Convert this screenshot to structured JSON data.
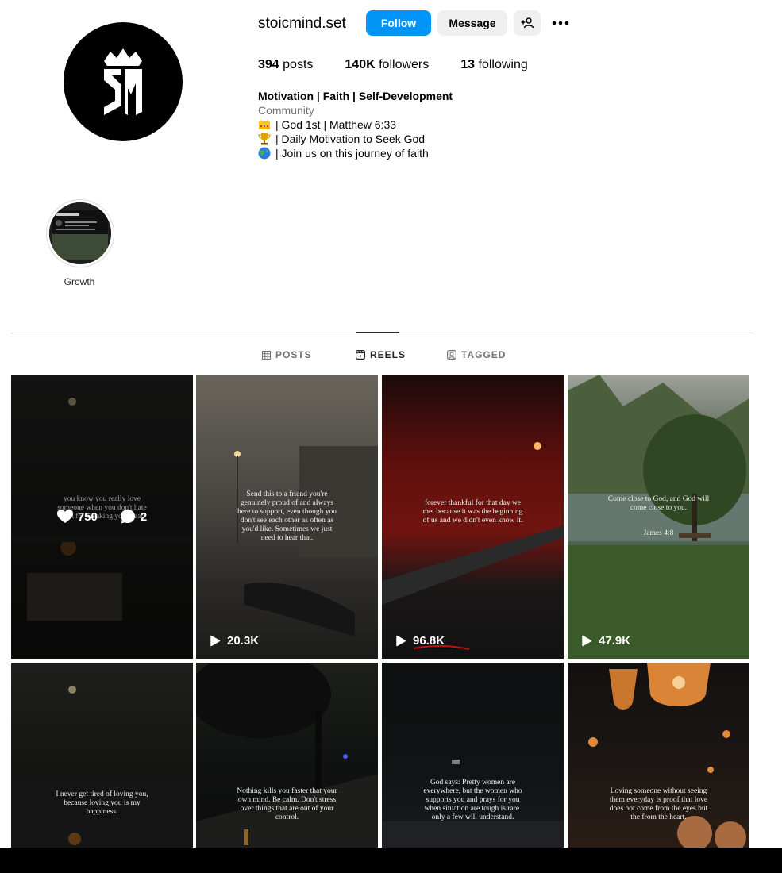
{
  "profile": {
    "username": "stoicmind.set",
    "follow_label": "Follow",
    "message_label": "Message",
    "posts_count": "394",
    "posts_label": "posts",
    "followers_count": "140K",
    "followers_label": "followers",
    "following_count": "13",
    "following_label": "following",
    "avatar_text": "SM",
    "bio": {
      "name": "Motivation | Faith | Self-Development",
      "category": "Community",
      "lines": [
        {
          "icon": "crown-emoji",
          "text": "| God 1st | Matthew 6:33"
        },
        {
          "icon": "trophy-emoji",
          "text": "| Daily Motivation to Seek God"
        },
        {
          "icon": "globe-emoji",
          "text": "| Join us on this journey of faith"
        }
      ]
    }
  },
  "highlights": [
    {
      "label": "Growth"
    }
  ],
  "tabs": [
    {
      "label": "POSTS",
      "icon": "grid-icon",
      "active": false
    },
    {
      "label": "REELS",
      "icon": "reels-icon",
      "active": true
    },
    {
      "label": "TAGGED",
      "icon": "tagged-icon",
      "active": false
    }
  ],
  "reels": [
    {
      "caption": "you know you really love someone when you don't hate them for breaking your heart",
      "likes": "750",
      "comments": "2",
      "hovered": true,
      "views": ""
    },
    {
      "caption": "Send this to a friend you're genuinely proud of and always here to support, even though you don't see each other as often as you'd like. Sometimes we just need to hear that.",
      "views": "20.3K"
    },
    {
      "caption": "forever thankful for that day we met because it was the beginning of us and we didn't even know it.",
      "views": "96.8K"
    },
    {
      "caption": "Come close to God, and God will come close to you.",
      "caption2": "James 4:8",
      "views": "47.9K"
    },
    {
      "caption": "I never get tired of loving you, because loving you is my happiness.",
      "views": ""
    },
    {
      "caption": "Nothing kills you faster that your own mind. Be calm. Don't stress over things that are out of your control.",
      "views": ""
    },
    {
      "caption": "God says: Pretty women are everywhere, but the women who supports you and prays for you when situation are tough is rare. only a few will understand.",
      "views": ""
    },
    {
      "caption": "Loving someone without seeing them everyday is proof that love does not come from the eyes but the from the heart.",
      "views": ""
    }
  ],
  "colors": {
    "follow": "#0095f6",
    "secondary": "#efefef"
  }
}
